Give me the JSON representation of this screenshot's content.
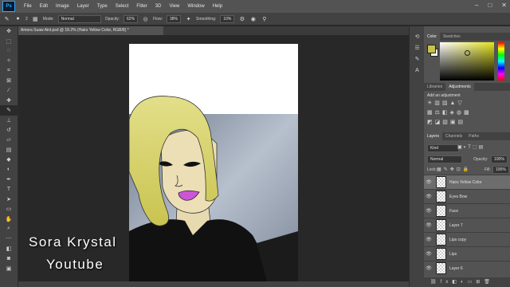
{
  "menu": {
    "logo": "Ps",
    "items": [
      "File",
      "Edit",
      "Image",
      "Layer",
      "Type",
      "Select",
      "Filter",
      "3D",
      "View",
      "Window",
      "Help"
    ]
  },
  "options_bar": {
    "brush_size": "2",
    "mode_label": "Mode:",
    "mode_value": "Normal",
    "opacity_label": "Opacity:",
    "opacity_value": "62%",
    "flow_label": "Flow:",
    "flow_value": "38%",
    "smoothing_label": "Smoothing:",
    "smoothing_value": "10%"
  },
  "document": {
    "tab_title": "Amora Suaw Ainl.psd @ 18.2% (Hairs Yellow Color, RGB/8) *"
  },
  "watermark": {
    "line1": "Sora  Krystal",
    "line2": "Youtube"
  },
  "color_panel": {
    "tabs": [
      "Color",
      "Swatches"
    ],
    "foreground": "#c7c24a",
    "background": "#ffffff"
  },
  "adjustments_panel": {
    "tabs": [
      "Libraries",
      "Adjustments"
    ],
    "title": "Add an adjustment"
  },
  "layers_panel": {
    "tabs": [
      "Layers",
      "Channels",
      "Paths"
    ],
    "kind_label": "Kind",
    "blend_mode": "Normal",
    "opacity_label": "Opacity:",
    "opacity_value": "100%",
    "lock_label": "Lock:",
    "fill_label": "Fill:",
    "fill_value": "100%",
    "layers": [
      {
        "name": "Hairs Yellow Color",
        "selected": true
      },
      {
        "name": "Eyes Bow",
        "selected": false
      },
      {
        "name": "Face",
        "selected": false
      },
      {
        "name": "Layer 7",
        "selected": false
      },
      {
        "name": "Lips copy",
        "selected": false
      },
      {
        "name": "Lips",
        "selected": false
      },
      {
        "name": "Layer 6",
        "selected": false
      }
    ]
  },
  "colors": {
    "app_bg": "#282828",
    "panel": "#535353",
    "toolbar": "#424242",
    "hair": "#d6d36a",
    "shirt": "#111111",
    "lips": "#cc55d6"
  }
}
